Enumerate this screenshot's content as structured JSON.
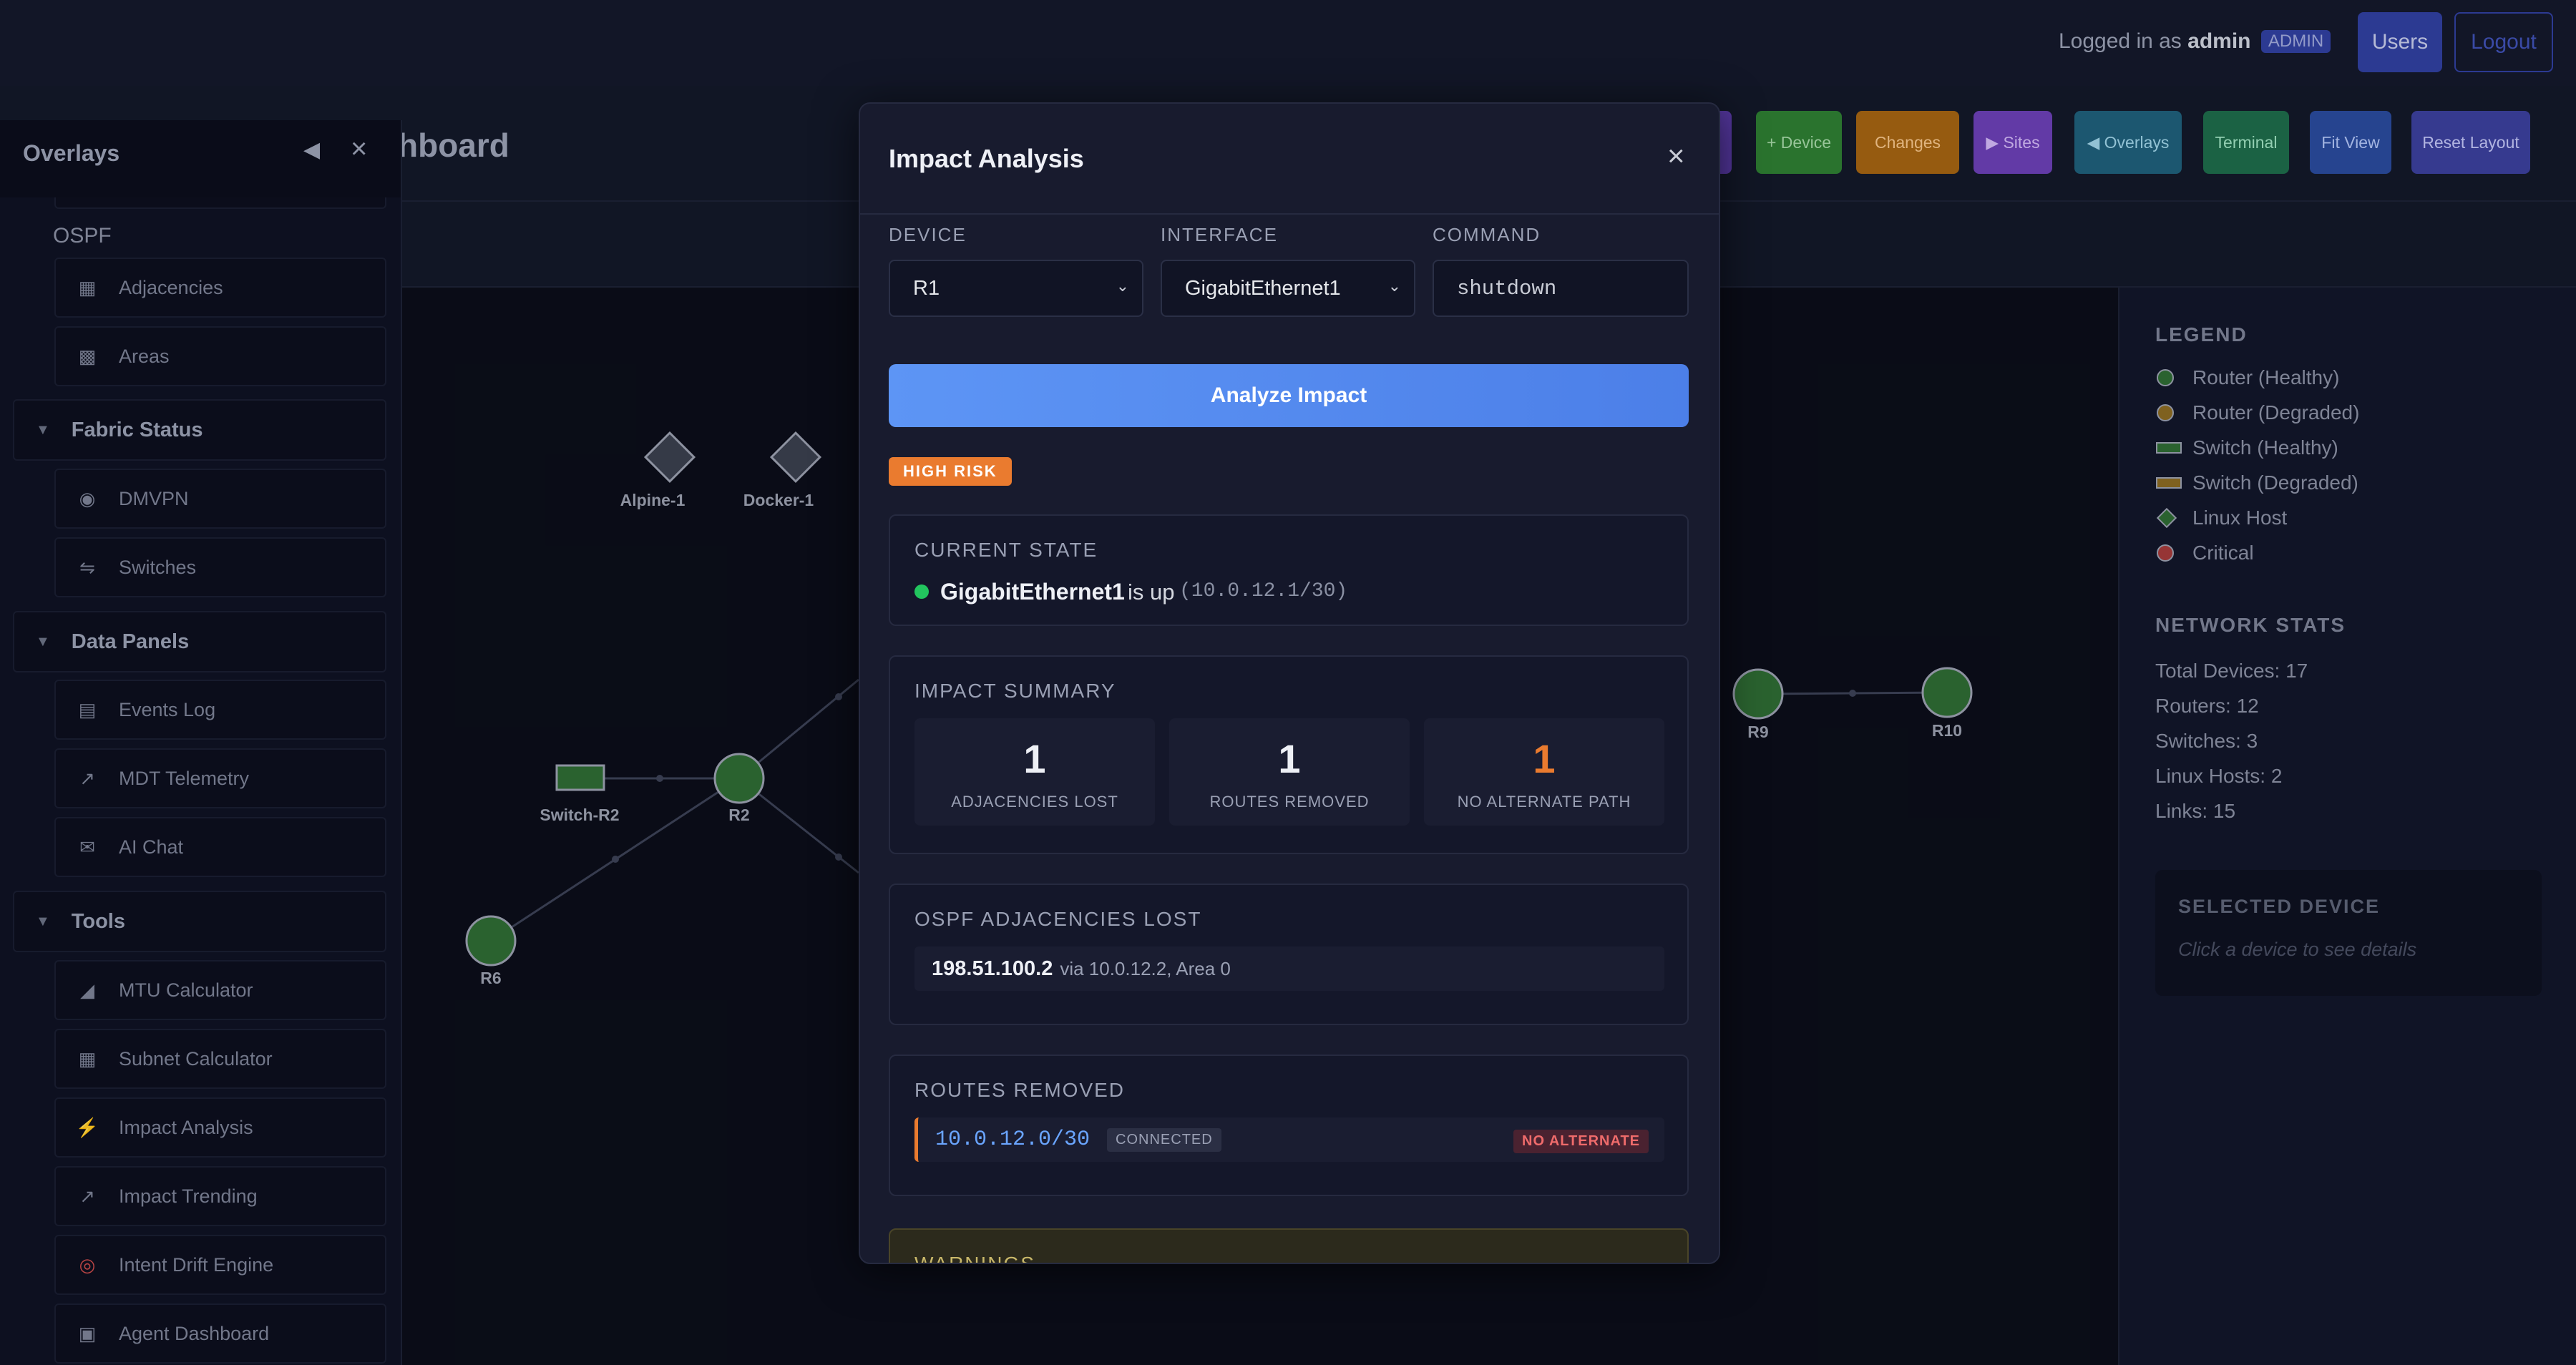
{
  "topbar": {
    "logged_in_prefix": "Logged in as",
    "username": "admin",
    "role_badge": "ADMIN",
    "users_label": "Users",
    "logout_label": "Logout"
  },
  "dashboard": {
    "title_fragment": "hboard"
  },
  "toolbar": {
    "buttons": [
      {
        "label": "+ Device",
        "color": "#2e7d32"
      },
      {
        "label": "Changes",
        "color": "#a36312"
      },
      {
        "label": "▶ Sites",
        "color": "#6b3fb5"
      },
      {
        "label": "◀ Overlays",
        "color": "#1f5f7a"
      },
      {
        "label": "Terminal",
        "color": "#1e6b4a"
      },
      {
        "label": "Fit View",
        "color": "#2a4a9c"
      },
      {
        "label": "Reset Layout",
        "color": "#3b3f9c"
      }
    ]
  },
  "sidebar": {
    "title": "Overlays",
    "ospf_label": "OSPF",
    "ospf_items": [
      {
        "icon": "adjacencies-icon",
        "label": "Adjacencies"
      },
      {
        "icon": "areas-icon",
        "label": "Areas"
      }
    ],
    "sections": [
      {
        "label": "Fabric Status",
        "items": [
          {
            "icon": "globe-icon",
            "label": "DMVPN"
          },
          {
            "icon": "plug-icon",
            "label": "Switches"
          }
        ]
      },
      {
        "label": "Data Panels",
        "items": [
          {
            "icon": "clipboard-icon",
            "label": "Events Log"
          },
          {
            "icon": "chart-icon",
            "label": "MDT Telemetry"
          },
          {
            "icon": "chat-icon",
            "label": "AI Chat"
          }
        ]
      },
      {
        "label": "Tools",
        "items": [
          {
            "icon": "ruler-icon",
            "label": "MTU Calculator"
          },
          {
            "icon": "calculator-icon",
            "label": "Subnet Calculator"
          },
          {
            "icon": "lightning-icon",
            "label": "Impact Analysis"
          },
          {
            "icon": "chart-icon",
            "label": "Impact Trending"
          },
          {
            "icon": "target-icon",
            "label": "Intent Drift Engine"
          },
          {
            "icon": "robot-icon",
            "label": "Agent Dashboard"
          }
        ]
      }
    ]
  },
  "topology": {
    "nodes": [
      {
        "label": "Alpine-1"
      },
      {
        "label": "Docker-1"
      },
      {
        "label": "Switch-R2"
      },
      {
        "label": "R2"
      },
      {
        "label": "R6"
      },
      {
        "label": "R9"
      },
      {
        "label": "R10"
      }
    ]
  },
  "right_panel": {
    "legend_title": "LEGEND",
    "legend": [
      {
        "label": "Router (Healthy)",
        "shape": "circle",
        "color": "#2e6b34"
      },
      {
        "label": "Router (Degraded)",
        "shape": "circle",
        "color": "#8a6a22"
      },
      {
        "label": "Switch (Healthy)",
        "shape": "rect",
        "color": "#2e6b34"
      },
      {
        "label": "Switch (Degraded)",
        "shape": "rect",
        "color": "#8a6a22"
      },
      {
        "label": "Linux Host",
        "shape": "diamond",
        "color": "#2e6b34"
      },
      {
        "label": "Critical",
        "shape": "circle",
        "color": "#a33a3a"
      }
    ],
    "stats_title": "NETWORK STATS",
    "stats": [
      "Total Devices: 17",
      "Routers: 12",
      "Switches: 3",
      "Linux Hosts: 2",
      "Links: 15"
    ],
    "selected_title": "SELECTED DEVICE",
    "selected_hint": "Click a device to see details"
  },
  "modal": {
    "title": "Impact Analysis",
    "close_symbol": "×",
    "device_label": "DEVICE",
    "device_value": "R1",
    "interface_label": "INTERFACE",
    "interface_value": "GigabitEthernet1",
    "command_label": "COMMAND",
    "command_value": "shutdown",
    "analyze_label": "Analyze Impact",
    "risk_badge": "HIGH RISK",
    "current_state": {
      "title": "CURRENT STATE",
      "interface": "GigabitEthernet1",
      "status": "is up",
      "ip": "(10.0.12.1/30)"
    },
    "impact_summary": {
      "title": "IMPACT SUMMARY",
      "items": [
        {
          "value": "1",
          "label": "ADJACENCIES LOST",
          "color": "#eef0f6"
        },
        {
          "value": "1",
          "label": "ROUTES REMOVED",
          "color": "#eef0f6"
        },
        {
          "value": "1",
          "label": "NO ALTERNATE PATH",
          "color": "#ea7b2f"
        }
      ]
    },
    "adjacencies": {
      "title": "OSPF ADJACENCIES LOST",
      "rows": [
        {
          "neighbor": "198.51.100.2",
          "detail": "via 10.0.12.2, Area 0"
        }
      ]
    },
    "routes": {
      "title": "ROUTES REMOVED",
      "rows": [
        {
          "prefix": "10.0.12.0/30",
          "type": "CONNECTED",
          "alt": "NO ALTERNATE"
        }
      ]
    },
    "warnings_title": "WARNINGS"
  }
}
